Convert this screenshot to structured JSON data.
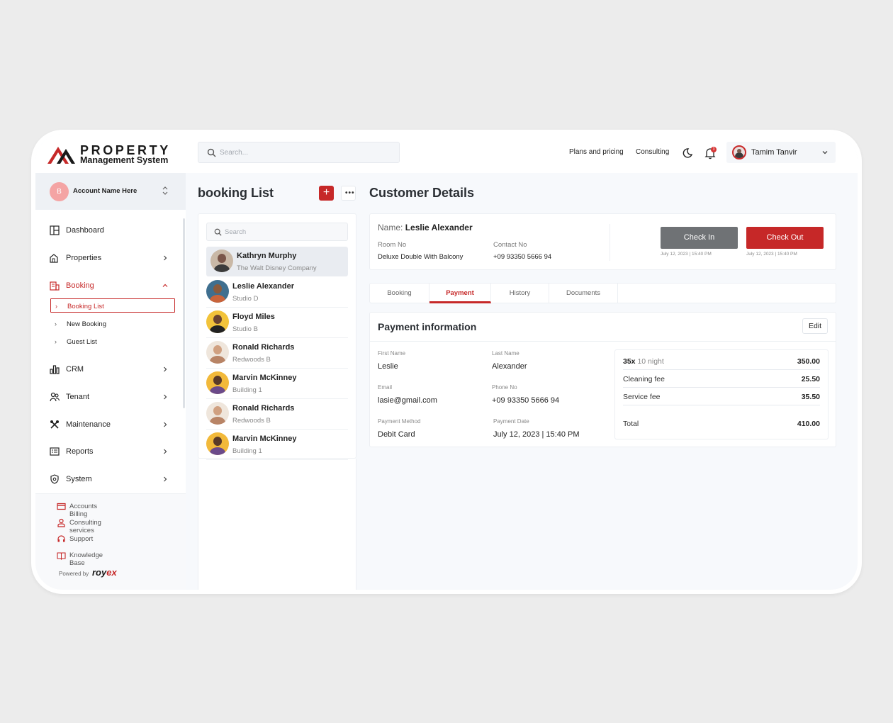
{
  "header": {
    "logo_title": "PROPERTY",
    "logo_subtitle": "Management System",
    "search_placeholder": "Search...",
    "links": [
      "Plans and pricing",
      "Consulting"
    ],
    "notification_count": "3",
    "user_name": "Tamim Tanvir"
  },
  "sidebar": {
    "account_initial": "B",
    "account_name": "Account Name Here",
    "items": [
      {
        "label": "Dashboard",
        "icon": "dashboard-icon"
      },
      {
        "label": "Properties",
        "icon": "properties-icon"
      },
      {
        "label": "Booking",
        "icon": "booking-icon"
      },
      {
        "label": "CRM",
        "icon": "crm-icon"
      },
      {
        "label": "Tenant",
        "icon": "tenant-icon"
      },
      {
        "label": "Maintenance",
        "icon": "maintenance-icon"
      },
      {
        "label": "Reports",
        "icon": "reports-icon"
      },
      {
        "label": "System",
        "icon": "system-icon"
      }
    ],
    "booking_sub": [
      "Booking List",
      "New Booking",
      "Guest List"
    ],
    "utilities": [
      "Accounts Billing",
      "Consulting services",
      "Support",
      "Knowledge Base"
    ],
    "powered_by": "Powered by",
    "brand_a": "roy",
    "brand_b": "ex"
  },
  "booking_list": {
    "title": "booking List",
    "add_label": "+",
    "more_label": "•••",
    "search_placeholder": "Search",
    "people": [
      {
        "name": "Kathryn Murphy",
        "sub": "The Walt Disney Company",
        "skin": "#7a5548",
        "shirt": "#3b3b3b",
        "bg": "#c9b8a6"
      },
      {
        "name": "Leslie Alexander",
        "sub": "Studio D",
        "skin": "#8a5a3c",
        "shirt": "#c9643b",
        "bg": "#3f6f8f"
      },
      {
        "name": "Floyd Miles",
        "sub": "Studio B",
        "skin": "#6b4430",
        "shirt": "#222222",
        "bg": "#f2c33a"
      },
      {
        "name": "Ronald Richards",
        "sub": "Redwoods B",
        "skin": "#d0a080",
        "shirt": "#b88466",
        "bg": "#efe6dc"
      },
      {
        "name": "Marvin McKinney",
        "sub": "Building 1",
        "skin": "#5a3a28",
        "shirt": "#6b4a8a",
        "bg": "#f2b93a"
      },
      {
        "name": "Ronald Richards",
        "sub": "Redwoods B",
        "skin": "#d0a080",
        "shirt": "#b88466",
        "bg": "#efe6dc"
      },
      {
        "name": "Marvin McKinney",
        "sub": "Building 1",
        "skin": "#5a3a28",
        "shirt": "#6b4a8a",
        "bg": "#f2b93a"
      }
    ]
  },
  "customer": {
    "title": "Customer Details",
    "name_label": "Name:",
    "name": "Leslie Alexander",
    "room_label": "Room No",
    "room_value": "Deluxe Double With Balcony",
    "contact_label": "Contact No",
    "contact_value": "+09 93350 5666 94",
    "checkin_label": "Check In",
    "checkin_time": "July 12, 2023 | 15:40 PM",
    "checkout_label": "Check Out",
    "checkout_time": "July 12, 2023 | 15:40 PM",
    "tabs": [
      "Booking",
      "Payment",
      "History",
      "Documents"
    ],
    "active_tab": "Payment"
  },
  "payment": {
    "title": "Payment information",
    "edit_label": "Edit",
    "fields": {
      "first_name_label": "First Name",
      "first_name": "Leslie",
      "last_name_label": "Last Name",
      "last_name": "Alexander",
      "email_label": "Email",
      "email": "lasie@gmail.com",
      "phone_label": "Phone No",
      "phone": "+09 93350 5666 94",
      "method_label": "Payment Method",
      "method": "Debit Card",
      "date_label": "Payment Date",
      "date": "July 12, 2023 | 15:40 PM"
    },
    "summary": {
      "nights_qty": "35x",
      "nights_label": "10 night",
      "nights_value": "350.00",
      "cleaning_label": "Cleaning fee",
      "cleaning_value": "25.50",
      "service_label": "Service fee",
      "service_value": "35.50",
      "total_label": "Total",
      "total_value": "410.00"
    }
  },
  "colors": {
    "accent": "#c62828",
    "checkin": "#6f7275"
  }
}
